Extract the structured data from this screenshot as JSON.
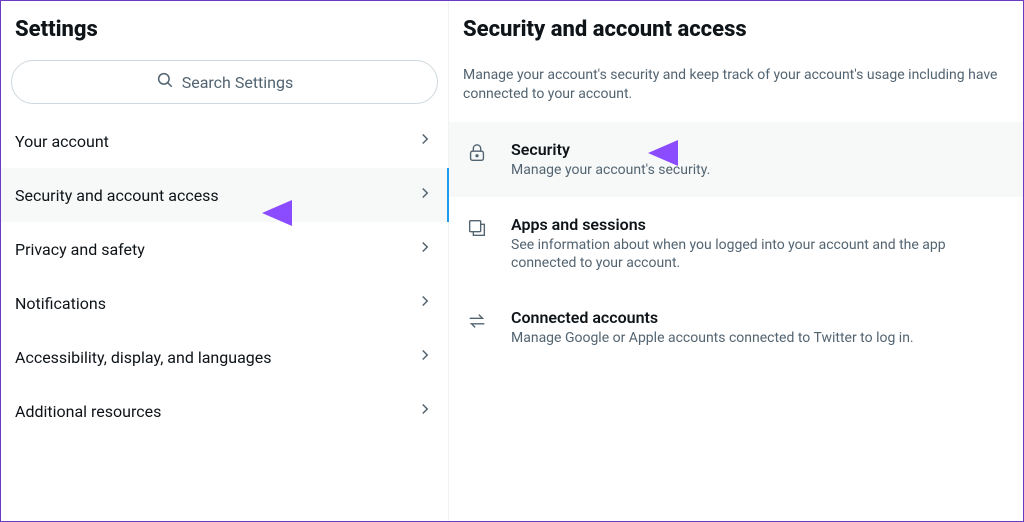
{
  "left": {
    "title": "Settings",
    "search_placeholder": "Search Settings",
    "items": [
      {
        "label": "Your account"
      },
      {
        "label": "Security and account access"
      },
      {
        "label": "Privacy and safety"
      },
      {
        "label": "Notifications"
      },
      {
        "label": "Accessibility, display, and languages"
      },
      {
        "label": "Additional resources"
      }
    ]
  },
  "right": {
    "title": "Security and account access",
    "description": "Manage your account's security and keep track of your account's usage including have connected to your account.",
    "items": [
      {
        "title": "Security",
        "sub": "Manage your account's security."
      },
      {
        "title": "Apps and sessions",
        "sub": "See information about when you logged into your account and the app connected to your account."
      },
      {
        "title": "Connected accounts",
        "sub": "Manage Google or Apple accounts connected to Twitter to log in."
      }
    ]
  }
}
